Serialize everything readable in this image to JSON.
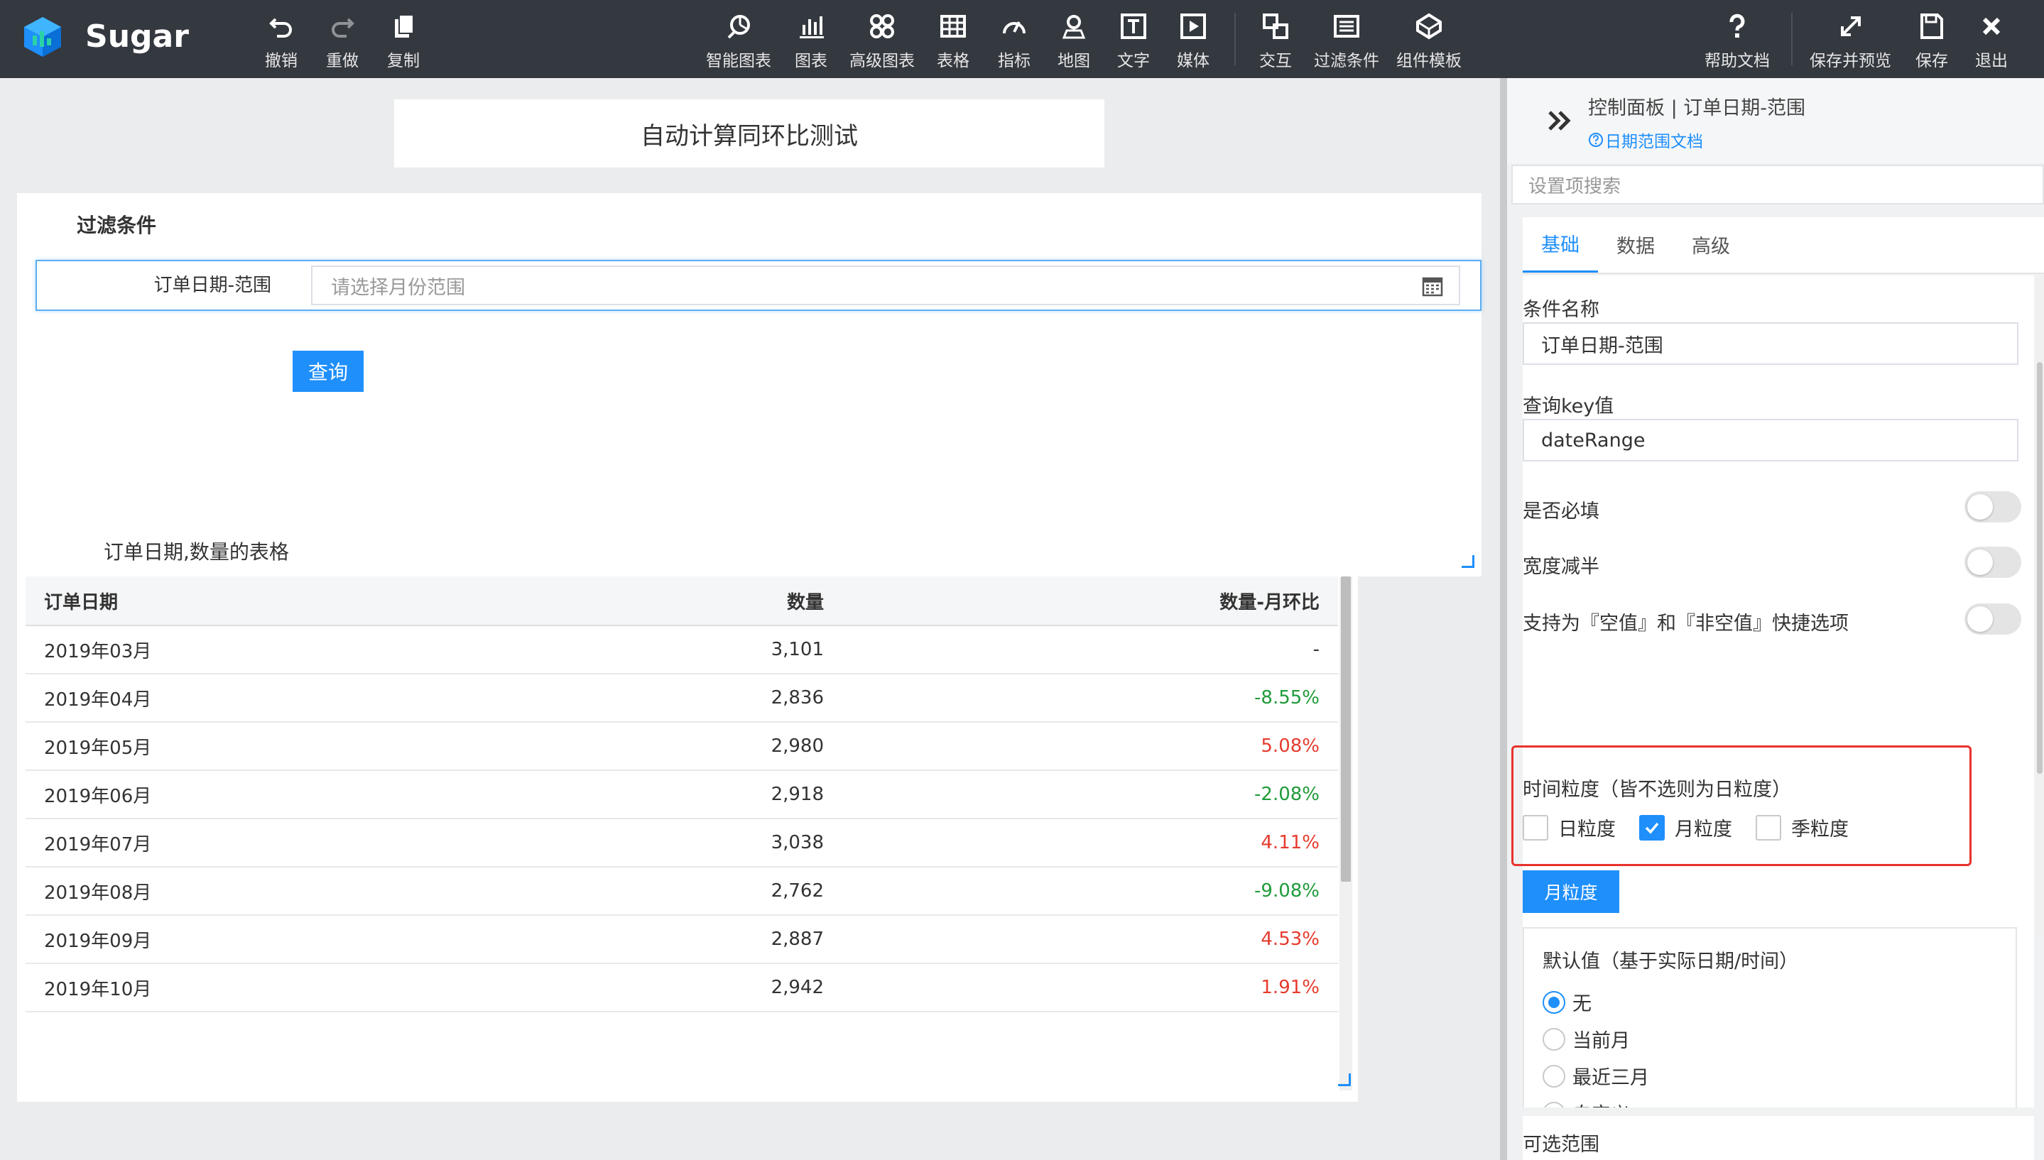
{
  "app": {
    "brand": "Sugar",
    "colors": {
      "topbar": "#34383f",
      "accent": "#1e8ffb",
      "positive": "#e63b2e",
      "negative": "#1f9b3a",
      "highlight": "#e8322c"
    }
  },
  "toolbar": {
    "left": [
      {
        "label": "撤销",
        "icon": "undo-icon"
      },
      {
        "label": "重做",
        "icon": "redo-icon"
      },
      {
        "label": "复制",
        "icon": "copy-icon"
      }
    ],
    "center": [
      {
        "label": "智能图表",
        "icon": "smart-chart-icon"
      },
      {
        "label": "图表",
        "icon": "bar-chart-icon"
      },
      {
        "label": "高级图表",
        "icon": "advanced-chart-icon"
      },
      {
        "label": "表格",
        "icon": "table-icon"
      },
      {
        "label": "指标",
        "icon": "gauge-icon"
      },
      {
        "label": "地图",
        "icon": "map-pin-icon"
      },
      {
        "label": "文字",
        "icon": "text-icon"
      },
      {
        "label": "媒体",
        "icon": "media-icon"
      },
      {
        "label": "交互",
        "icon": "interaction-icon"
      },
      {
        "label": "过滤条件",
        "icon": "filter-icon"
      },
      {
        "label": "组件模板",
        "icon": "template-icon"
      }
    ],
    "right": [
      {
        "label": "帮助文档",
        "icon": "help-icon"
      },
      {
        "label": "保存并预览",
        "icon": "expand-icon"
      },
      {
        "label": "保存",
        "icon": "save-icon"
      },
      {
        "label": "退出",
        "icon": "close-icon"
      }
    ]
  },
  "canvas": {
    "title": "自动计算同环比测试",
    "filter": {
      "header": "过滤条件",
      "label": "订单日期-范围",
      "placeholder": "请选择月份范围",
      "query_button": "查询"
    },
    "table": {
      "header": "订单日期,数量的表格",
      "columns": [
        "订单日期",
        "数量",
        "数量-月环比"
      ],
      "rows": [
        {
          "date": "2019年03月",
          "qty": "3,101",
          "mom": "-",
          "trend": "none"
        },
        {
          "date": "2019年04月",
          "qty": "2,836",
          "mom": "-8.55%",
          "trend": "neg"
        },
        {
          "date": "2019年05月",
          "qty": "2,980",
          "mom": "5.08%",
          "trend": "pos"
        },
        {
          "date": "2019年06月",
          "qty": "2,918",
          "mom": "-2.08%",
          "trend": "neg"
        },
        {
          "date": "2019年07月",
          "qty": "3,038",
          "mom": "4.11%",
          "trend": "pos"
        },
        {
          "date": "2019年08月",
          "qty": "2,762",
          "mom": "-9.08%",
          "trend": "neg"
        },
        {
          "date": "2019年09月",
          "qty": "2,887",
          "mom": "4.53%",
          "trend": "pos"
        },
        {
          "date": "2019年10月",
          "qty": "2,942",
          "mom": "1.91%",
          "trend": "pos"
        }
      ]
    }
  },
  "panel": {
    "title": "控制面板 | 订单日期-范围",
    "doc_link": "日期范围文档",
    "search_placeholder": "设置项搜索",
    "tabs": [
      {
        "label": "基础",
        "active": true
      },
      {
        "label": "数据",
        "active": false
      },
      {
        "label": "高级",
        "active": false
      }
    ],
    "condition_name_label": "条件名称",
    "condition_name_value": "订单日期-范围",
    "query_key_label": "查询key值",
    "query_key_value": "dateRange",
    "required_label": "是否必填",
    "half_width_label": "宽度减半",
    "empty_option_label": "支持为『空值』和『非空值』快捷选项",
    "granularity_label": "时间粒度（皆不选则为日粒度）",
    "granularity_options": [
      {
        "label": "日粒度",
        "checked": false
      },
      {
        "label": "月粒度",
        "checked": true
      },
      {
        "label": "季粒度",
        "checked": false
      }
    ],
    "granularity_tag": "月粒度",
    "default_label": "默认值（基于实际日期/时间）",
    "default_options": [
      {
        "label": "无",
        "selected": true
      },
      {
        "label": "当前月",
        "selected": false
      },
      {
        "label": "最近三月",
        "selected": false
      },
      {
        "label": "自定义",
        "selected": false
      }
    ],
    "range_label": "可选范围"
  }
}
